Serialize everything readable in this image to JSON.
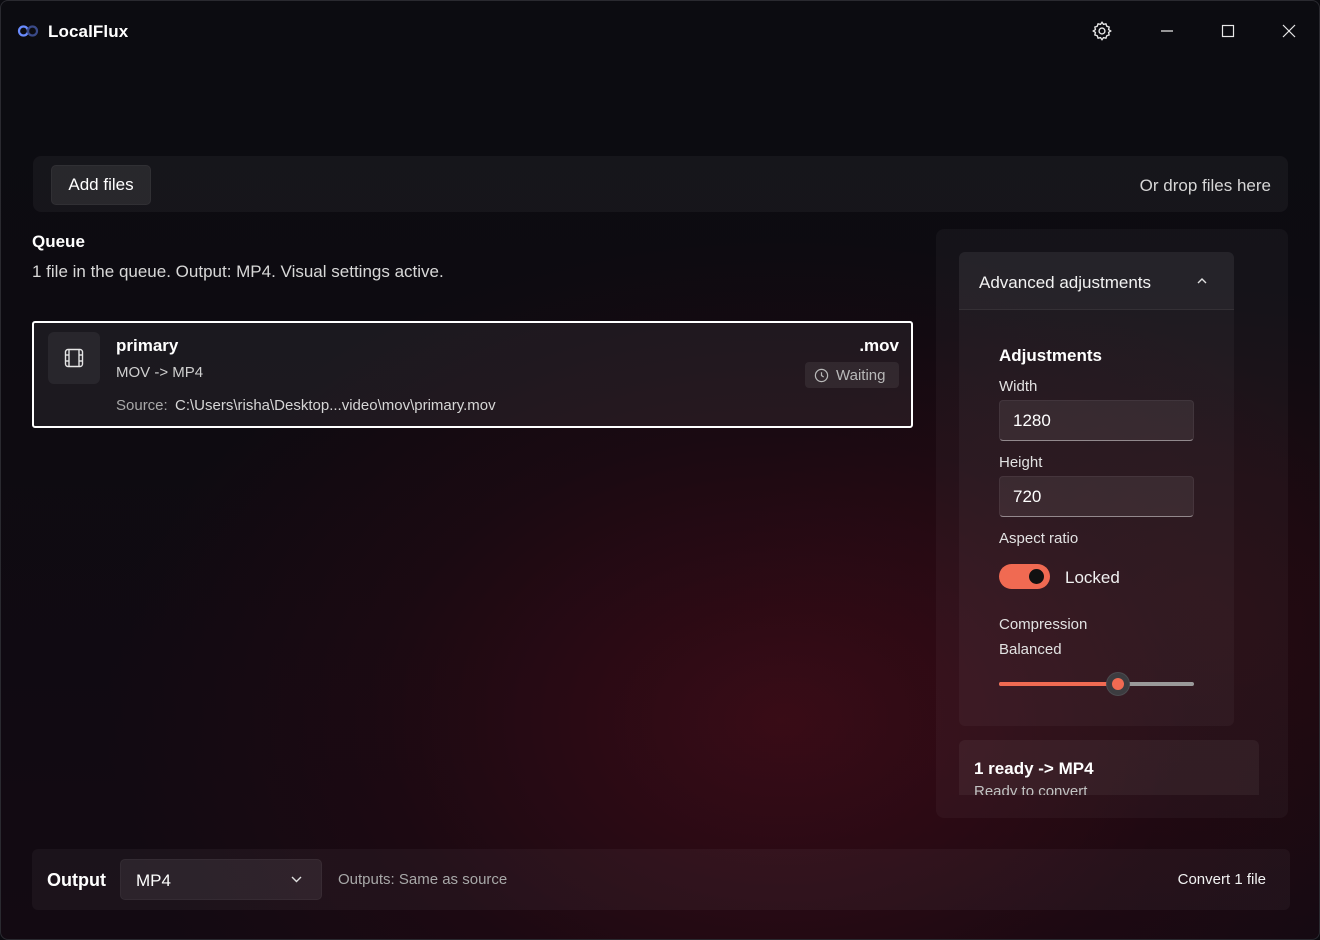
{
  "app": {
    "title": "LocalFlux"
  },
  "titlebar": {
    "icons": [
      "settings-icon",
      "minimize-icon",
      "maximize-icon",
      "close-icon"
    ]
  },
  "addbar": {
    "add_label": "Add files",
    "drop_hint": "Or drop files here"
  },
  "queue": {
    "title": "Queue",
    "subtitle": "1 file in the queue. Output: MP4. Visual settings active.",
    "files": [
      {
        "name": "primary",
        "conversion": "MOV -> MP4",
        "source_label": "Source:",
        "source_path": "C:\\Users\\risha\\Desktop...video\\mov\\primary.mov",
        "extension": ".mov",
        "status": "Waiting"
      }
    ]
  },
  "advanced": {
    "header": "Advanced adjustments",
    "section_title": "Adjustments",
    "width_label": "Width",
    "width_value": "1280",
    "height_label": "Height",
    "height_value": "720",
    "aspect_label": "Aspect ratio",
    "aspect_toggle_label": "Locked",
    "aspect_locked": true,
    "compression_label": "Compression",
    "compression_value": "Balanced",
    "compression_level": 0.61
  },
  "summary": {
    "title": "1 ready -> MP4",
    "subtitle": "Ready to convert"
  },
  "output": {
    "label": "Output",
    "format": "MP4",
    "hint": "Outputs: Same as source",
    "convert_label": "Convert 1 file"
  },
  "colors": {
    "accent": "#f06a52",
    "selected_border": "#ffffff"
  }
}
